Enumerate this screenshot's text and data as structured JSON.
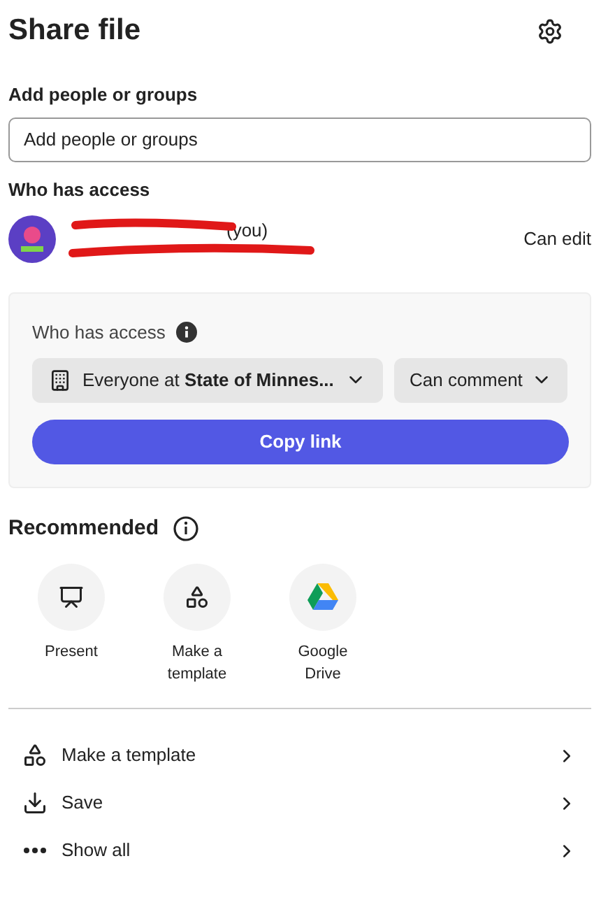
{
  "header": {
    "title": "Share file"
  },
  "add_people": {
    "label": "Add people or groups",
    "placeholder": "Add people or groups"
  },
  "who_has_access": {
    "label": "Who has access",
    "users": [
      {
        "suffix": "(you)",
        "permission": "Can edit"
      }
    ]
  },
  "link_card": {
    "label": "Who has access",
    "scope": "Everyone at **State of Minnes...**",
    "permission": "Can comment",
    "button": "Copy link"
  },
  "recommended": {
    "title": "Recommended",
    "items": [
      {
        "kind": "present",
        "label": "Present"
      },
      {
        "kind": "template",
        "label": "Make a template"
      },
      {
        "kind": "drive",
        "label": "Google Drive"
      }
    ]
  },
  "actions": [
    {
      "kind": "template",
      "label": "Make a template"
    },
    {
      "kind": "save",
      "label": "Save"
    },
    {
      "kind": "more",
      "label": "Show all"
    }
  ]
}
